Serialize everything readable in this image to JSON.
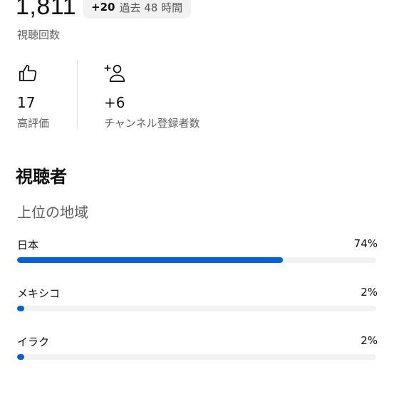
{
  "views": {
    "count": "1,811",
    "label": "視聴回数",
    "delta_value": "+20",
    "delta_text": "過去 48 時間"
  },
  "stats": {
    "likes": {
      "icon": "thumbs-up-icon",
      "value": "17",
      "label": "高評価"
    },
    "subscribers": {
      "icon": "add-person-icon",
      "value": "+6",
      "label": "チャンネル登録者数"
    }
  },
  "audience": {
    "title": "視聴者",
    "regions_title": "上位の地域",
    "regions": [
      {
        "name": "日本",
        "percent_label": "74%",
        "value": 74
      },
      {
        "name": "メキシコ",
        "percent_label": "2%",
        "value": 2
      },
      {
        "name": "イラク",
        "percent_label": "2%",
        "value": 2
      }
    ]
  },
  "colors": {
    "bar_fill": "#065fd4",
    "bar_track": "#f2f2f2",
    "chip_bg": "#f2f2f2"
  }
}
